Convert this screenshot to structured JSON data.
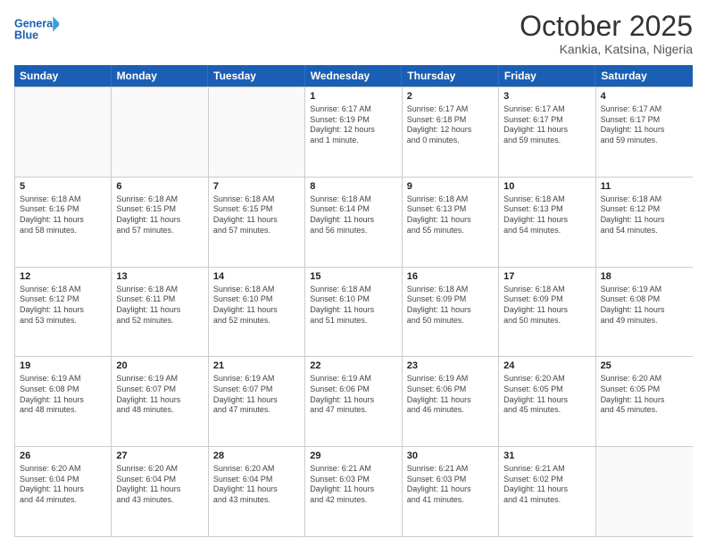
{
  "header": {
    "logo_line1": "General",
    "logo_line2": "Blue",
    "month": "October 2025",
    "location": "Kankia, Katsina, Nigeria"
  },
  "days": [
    "Sunday",
    "Monday",
    "Tuesday",
    "Wednesday",
    "Thursday",
    "Friday",
    "Saturday"
  ],
  "rows": [
    [
      {
        "date": "",
        "info": ""
      },
      {
        "date": "",
        "info": ""
      },
      {
        "date": "",
        "info": ""
      },
      {
        "date": "1",
        "info": "Sunrise: 6:17 AM\nSunset: 6:19 PM\nDaylight: 12 hours\nand 1 minute."
      },
      {
        "date": "2",
        "info": "Sunrise: 6:17 AM\nSunset: 6:18 PM\nDaylight: 12 hours\nand 0 minutes."
      },
      {
        "date": "3",
        "info": "Sunrise: 6:17 AM\nSunset: 6:17 PM\nDaylight: 11 hours\nand 59 minutes."
      },
      {
        "date": "4",
        "info": "Sunrise: 6:17 AM\nSunset: 6:17 PM\nDaylight: 11 hours\nand 59 minutes."
      }
    ],
    [
      {
        "date": "5",
        "info": "Sunrise: 6:18 AM\nSunset: 6:16 PM\nDaylight: 11 hours\nand 58 minutes."
      },
      {
        "date": "6",
        "info": "Sunrise: 6:18 AM\nSunset: 6:15 PM\nDaylight: 11 hours\nand 57 minutes."
      },
      {
        "date": "7",
        "info": "Sunrise: 6:18 AM\nSunset: 6:15 PM\nDaylight: 11 hours\nand 57 minutes."
      },
      {
        "date": "8",
        "info": "Sunrise: 6:18 AM\nSunset: 6:14 PM\nDaylight: 11 hours\nand 56 minutes."
      },
      {
        "date": "9",
        "info": "Sunrise: 6:18 AM\nSunset: 6:13 PM\nDaylight: 11 hours\nand 55 minutes."
      },
      {
        "date": "10",
        "info": "Sunrise: 6:18 AM\nSunset: 6:13 PM\nDaylight: 11 hours\nand 54 minutes."
      },
      {
        "date": "11",
        "info": "Sunrise: 6:18 AM\nSunset: 6:12 PM\nDaylight: 11 hours\nand 54 minutes."
      }
    ],
    [
      {
        "date": "12",
        "info": "Sunrise: 6:18 AM\nSunset: 6:12 PM\nDaylight: 11 hours\nand 53 minutes."
      },
      {
        "date": "13",
        "info": "Sunrise: 6:18 AM\nSunset: 6:11 PM\nDaylight: 11 hours\nand 52 minutes."
      },
      {
        "date": "14",
        "info": "Sunrise: 6:18 AM\nSunset: 6:10 PM\nDaylight: 11 hours\nand 52 minutes."
      },
      {
        "date": "15",
        "info": "Sunrise: 6:18 AM\nSunset: 6:10 PM\nDaylight: 11 hours\nand 51 minutes."
      },
      {
        "date": "16",
        "info": "Sunrise: 6:18 AM\nSunset: 6:09 PM\nDaylight: 11 hours\nand 50 minutes."
      },
      {
        "date": "17",
        "info": "Sunrise: 6:18 AM\nSunset: 6:09 PM\nDaylight: 11 hours\nand 50 minutes."
      },
      {
        "date": "18",
        "info": "Sunrise: 6:19 AM\nSunset: 6:08 PM\nDaylight: 11 hours\nand 49 minutes."
      }
    ],
    [
      {
        "date": "19",
        "info": "Sunrise: 6:19 AM\nSunset: 6:08 PM\nDaylight: 11 hours\nand 48 minutes."
      },
      {
        "date": "20",
        "info": "Sunrise: 6:19 AM\nSunset: 6:07 PM\nDaylight: 11 hours\nand 48 minutes."
      },
      {
        "date": "21",
        "info": "Sunrise: 6:19 AM\nSunset: 6:07 PM\nDaylight: 11 hours\nand 47 minutes."
      },
      {
        "date": "22",
        "info": "Sunrise: 6:19 AM\nSunset: 6:06 PM\nDaylight: 11 hours\nand 47 minutes."
      },
      {
        "date": "23",
        "info": "Sunrise: 6:19 AM\nSunset: 6:06 PM\nDaylight: 11 hours\nand 46 minutes."
      },
      {
        "date": "24",
        "info": "Sunrise: 6:20 AM\nSunset: 6:05 PM\nDaylight: 11 hours\nand 45 minutes."
      },
      {
        "date": "25",
        "info": "Sunrise: 6:20 AM\nSunset: 6:05 PM\nDaylight: 11 hours\nand 45 minutes."
      }
    ],
    [
      {
        "date": "26",
        "info": "Sunrise: 6:20 AM\nSunset: 6:04 PM\nDaylight: 11 hours\nand 44 minutes."
      },
      {
        "date": "27",
        "info": "Sunrise: 6:20 AM\nSunset: 6:04 PM\nDaylight: 11 hours\nand 43 minutes."
      },
      {
        "date": "28",
        "info": "Sunrise: 6:20 AM\nSunset: 6:04 PM\nDaylight: 11 hours\nand 43 minutes."
      },
      {
        "date": "29",
        "info": "Sunrise: 6:21 AM\nSunset: 6:03 PM\nDaylight: 11 hours\nand 42 minutes."
      },
      {
        "date": "30",
        "info": "Sunrise: 6:21 AM\nSunset: 6:03 PM\nDaylight: 11 hours\nand 41 minutes."
      },
      {
        "date": "31",
        "info": "Sunrise: 6:21 AM\nSunset: 6:02 PM\nDaylight: 11 hours\nand 41 minutes."
      },
      {
        "date": "",
        "info": ""
      }
    ]
  ]
}
